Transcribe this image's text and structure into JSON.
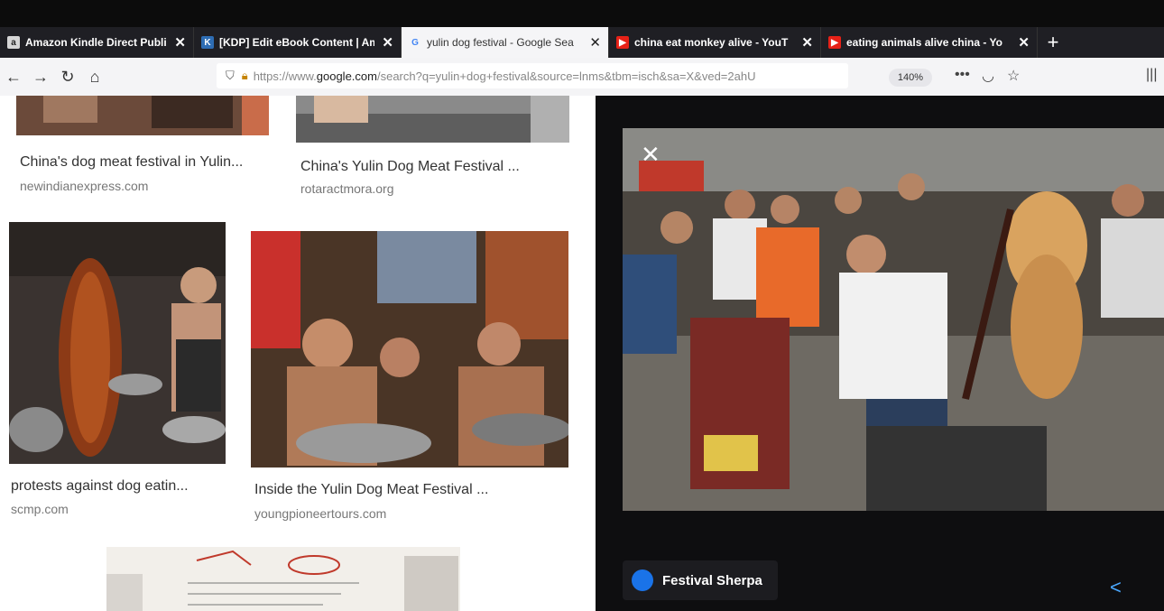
{
  "browser": {
    "tabs": [
      {
        "label": "Amazon Kindle Direct Publishi",
        "icon": "amazon-icon"
      },
      {
        "label": "[KDP] Edit eBook Content | Am",
        "icon": "kdp-icon"
      },
      {
        "label": "yulin dog festival - Google Sea",
        "icon": "google-icon",
        "active": true
      },
      {
        "label": "china eat monkey alive - YouT",
        "icon": "youtube-icon"
      },
      {
        "label": "eating animals alive china - Yo",
        "icon": "youtube-icon"
      }
    ],
    "url_prefix": "https://www.",
    "url_domain": "google.com",
    "url_rest": "/search?q=yulin+dog+festival&source=lnms&tbm=isch&sa=X&ved=2ahU",
    "zoom": "140%"
  },
  "results": [
    {
      "title": "China's dog meat festival in Yulin...",
      "source": "newindianexpress.com"
    },
    {
      "title": "China's Yulin Dog Meat Festival ...",
      "source": "rotaractmora.org"
    },
    {
      "title": "protests against dog eatin...",
      "source": "scmp.com"
    },
    {
      "title": "Inside the Yulin Dog Meat Festival ...",
      "source": "youngpioneertours.com"
    }
  ],
  "viewer": {
    "close_glyph": "✕",
    "site_name": "Festival Sherpa"
  }
}
